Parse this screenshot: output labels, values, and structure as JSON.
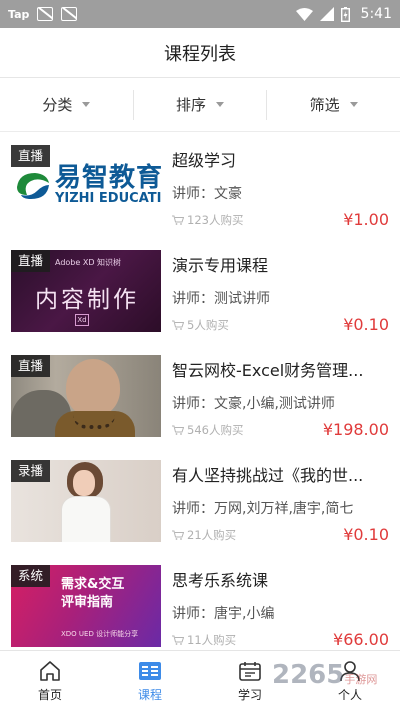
{
  "status_bar": {
    "carrier": "Tap",
    "time": "5:41"
  },
  "header": {
    "title": "课程列表"
  },
  "filters": [
    {
      "label": "分类"
    },
    {
      "label": "排序"
    },
    {
      "label": "筛选"
    }
  ],
  "courses": [
    {
      "tag": "直播",
      "title": "超级学习",
      "teacher": "讲师：文豪",
      "buyers": "123人购买",
      "price": "¥1.00",
      "thumb": {
        "line1": "易智教育",
        "line2": "YIZHI EDUCATION"
      }
    },
    {
      "tag": "直播",
      "title": "演示专用课程",
      "teacher": "讲师：测试讲师",
      "buyers": "5人购买",
      "price": "¥0.10",
      "thumb": {
        "line1": "Adobe XD 知识树",
        "line2": "内容制作",
        "line3": "Xd"
      }
    },
    {
      "tag": "直播",
      "title": "智云网校-Excel财务管理...",
      "teacher": "讲师：文豪,小编,测试讲师",
      "buyers": "546人购买",
      "price": "¥198.00"
    },
    {
      "tag": "录播",
      "title": "有人坚持挑战过《我的世...",
      "teacher": "讲师：万网,刘万祥,唐宇,简七",
      "buyers": "21人购买",
      "price": "¥0.10"
    },
    {
      "tag": "系统",
      "title": "思考乐系统课",
      "teacher": "讲师：唐宇,小编",
      "buyers": "11人购买",
      "price": "¥66.00",
      "thumb": {
        "line1": "需求&交互",
        "line2": "评审指南",
        "line3": "XDO UED 设计师能分享"
      }
    }
  ],
  "tabs": [
    {
      "label": "首页",
      "icon": "home-icon",
      "active": false
    },
    {
      "label": "课程",
      "icon": "course-list-icon",
      "active": true
    },
    {
      "label": "学习",
      "icon": "calendar-icon",
      "active": false
    },
    {
      "label": "个人",
      "icon": "user-icon",
      "active": false
    }
  ],
  "watermark": {
    "text": "2265",
    "sub": "手游网"
  },
  "colors": {
    "accent": "#3d8be8",
    "price": "#e03b3b",
    "status_bar": "#9e9e9e"
  }
}
